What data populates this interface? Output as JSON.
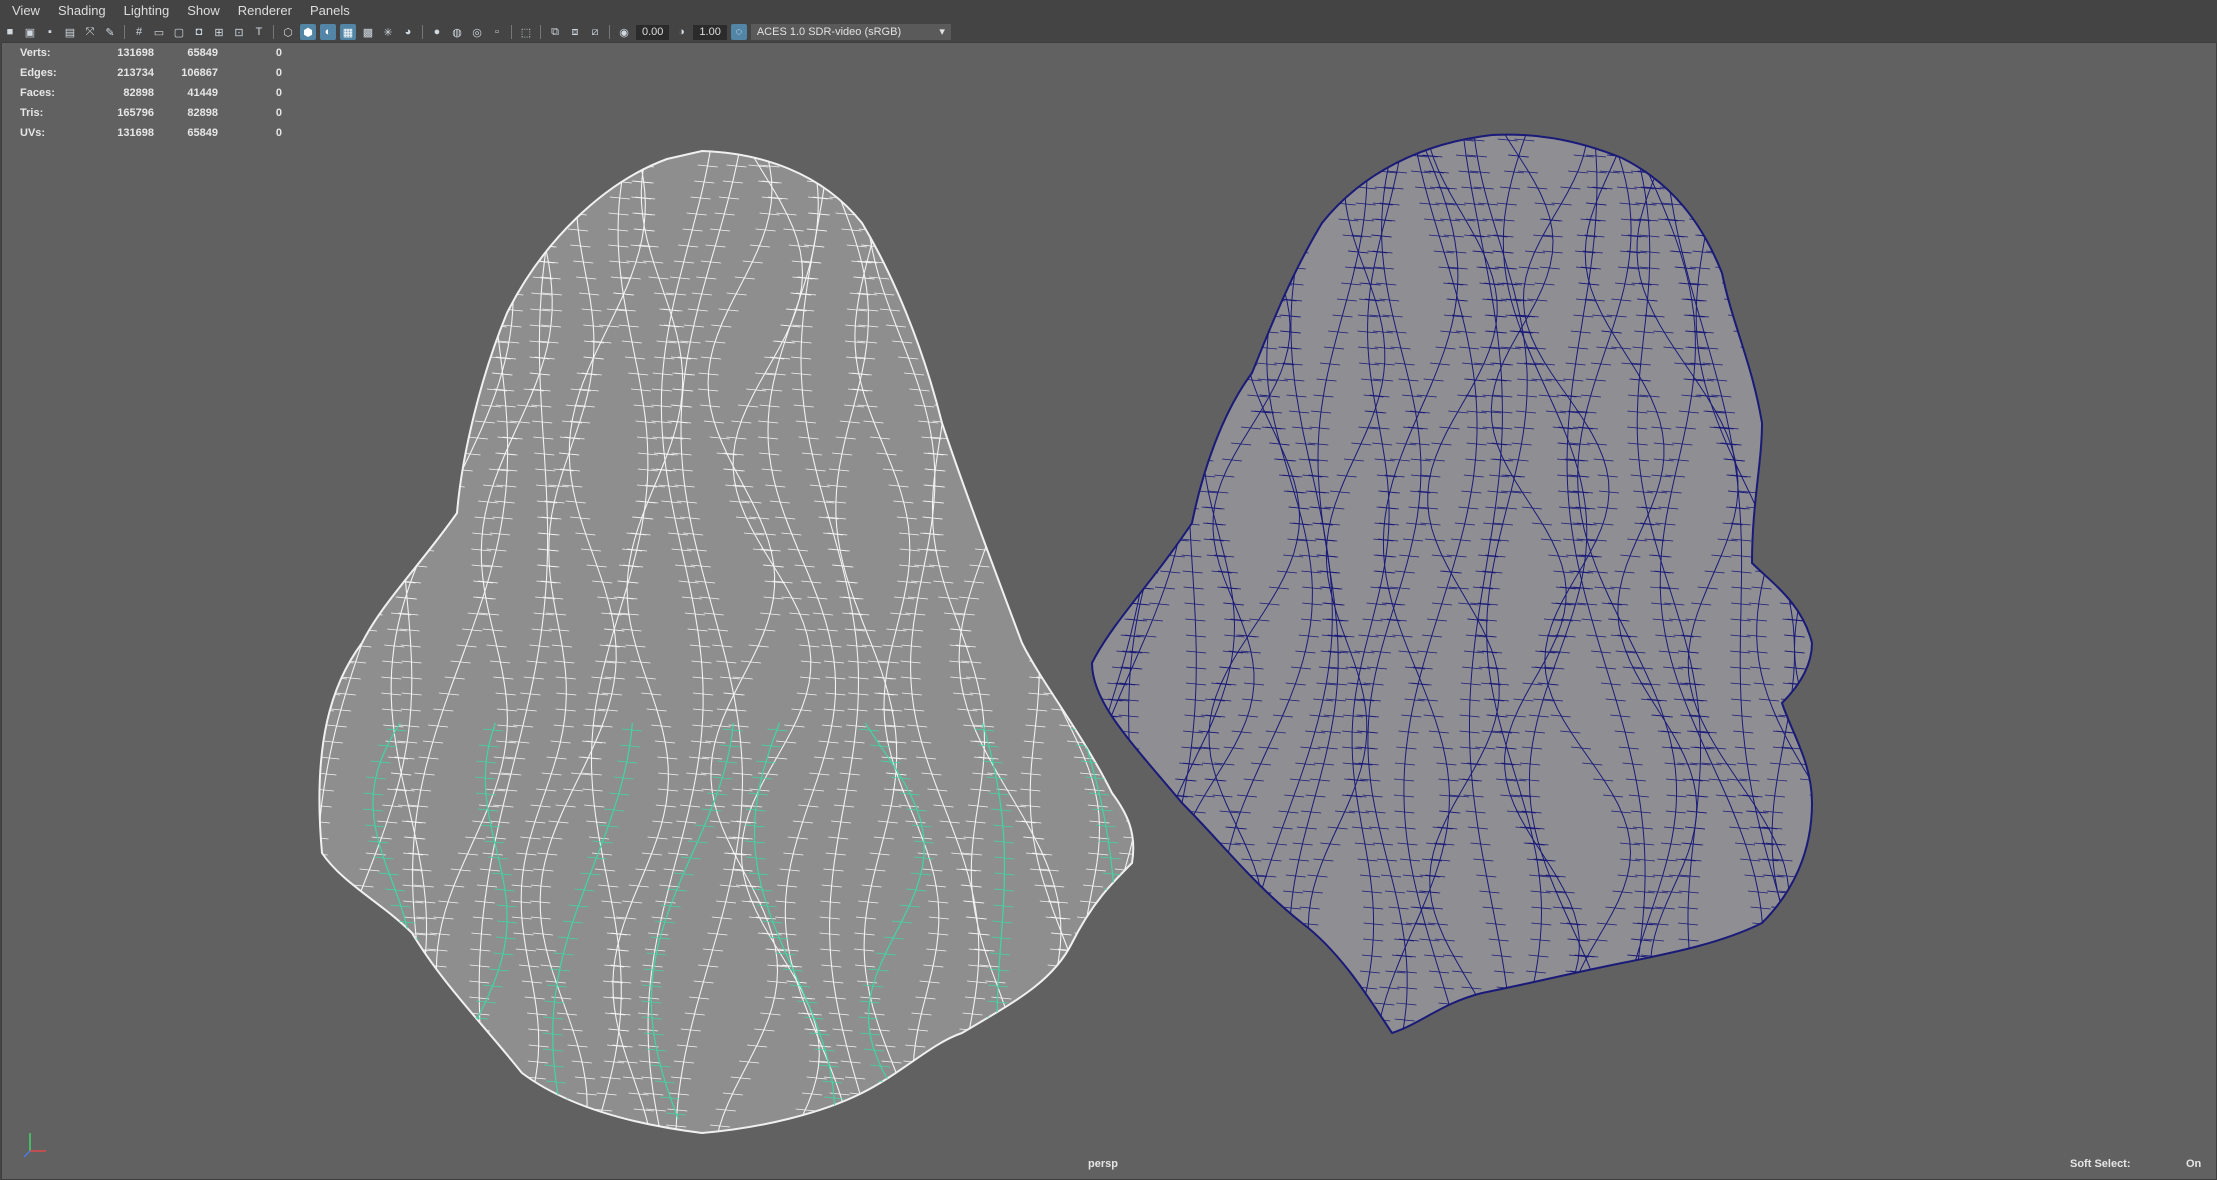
{
  "menu": [
    "View",
    "Shading",
    "Lighting",
    "Show",
    "Renderer",
    "Panels"
  ],
  "toolbar": {
    "exposure": "0.00",
    "gamma": "1.00",
    "color_space": "ACES 1.0 SDR-video (sRGB)"
  },
  "hud": {
    "rows": [
      {
        "label": "Verts:",
        "v1": "131698",
        "v2": "65849",
        "v3": "0"
      },
      {
        "label": "Edges:",
        "v1": "213734",
        "v2": "106867",
        "v3": "0"
      },
      {
        "label": "Faces:",
        "v1": "82898",
        "v2": "41449",
        "v3": "0"
      },
      {
        "label": "Tris:",
        "v1": "165796",
        "v2": "82898",
        "v3": "0"
      },
      {
        "label": "UVs:",
        "v1": "131698",
        "v2": "65849",
        "v3": "0"
      }
    ]
  },
  "viewport": {
    "camera": "persp",
    "soft_select_label": "Soft Select:",
    "soft_select_value": "On"
  },
  "colors": {
    "viewport_bg": "#616161",
    "wire_white": "#f2f2f2",
    "wire_blue": "#1a1a78",
    "wire_green": "#3fd6a6",
    "mesh_gray": "#8f8f8f"
  }
}
